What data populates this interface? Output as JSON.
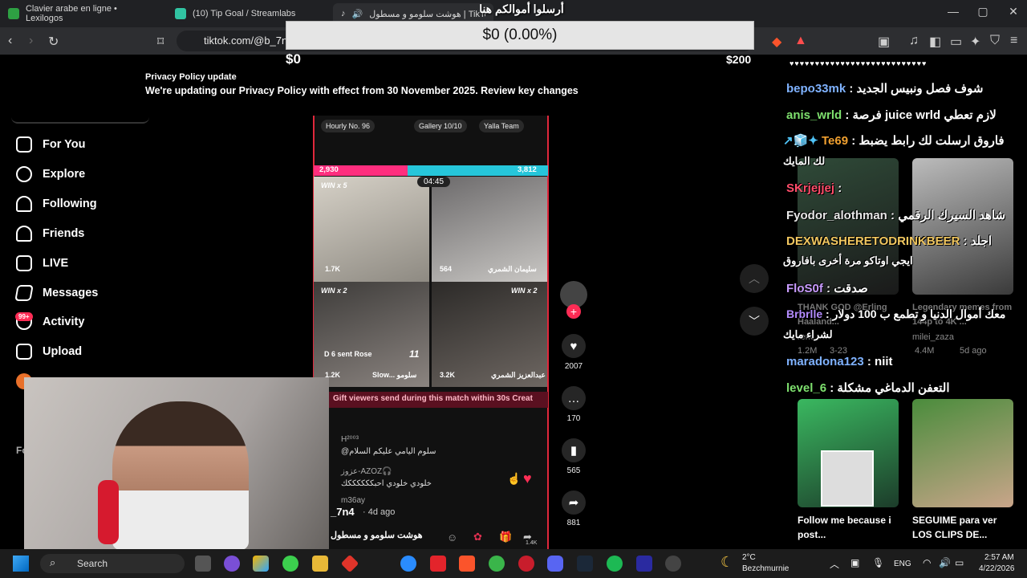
{
  "tabs": [
    {
      "title": "Clavier arabe en ligne • Lexilogos",
      "active": false
    },
    {
      "title": "(10) Tip Goal / Streamlabs",
      "active": false
    },
    {
      "title": "هوشت سلومو و مسطول | TikTok",
      "active": true
    }
  ],
  "window_controls": {
    "minimize": "—",
    "maximize": "▢",
    "close": "✕"
  },
  "url": "tiktok.com/@b_7n4",
  "tip_goal": {
    "title": "أرسلوا أموالكم هنا",
    "progress_text": "$0 (0.00%)",
    "progress_fraction": 0,
    "min": "$0",
    "max": "$200"
  },
  "privacy": {
    "title": "Privacy Policy update",
    "body": "We're updating our Privacy Policy with effect from 30 November 2025. Review key changes"
  },
  "sidebar": {
    "items": [
      {
        "label": "For You",
        "icon": "home-icon"
      },
      {
        "label": "Explore",
        "icon": "compass-icon"
      },
      {
        "label": "Following",
        "icon": "following-icon"
      },
      {
        "label": "Friends",
        "icon": "friends-icon"
      },
      {
        "label": "LIVE",
        "icon": "live-icon"
      },
      {
        "label": "Messages",
        "icon": "messages-icon"
      },
      {
        "label": "Activity",
        "icon": "activity-icon"
      },
      {
        "label": "Upload",
        "icon": "upload-icon"
      }
    ],
    "activity_badge": "99+",
    "partial_label": "Fo"
  },
  "video": {
    "top_chips": [
      "Hourly No. 96",
      "Gallery 10/10",
      "Yalla Team"
    ],
    "score_left": "2,930",
    "score_right": "3,812",
    "timer": "04:45",
    "cells": [
      {
        "badge": "WIN x 5",
        "count": "1.7K",
        "name": ""
      },
      {
        "badge": "",
        "count": "564",
        "name": "سليمان الشمري"
      },
      {
        "badge": "WIN x 2",
        "count": "1.2K",
        "name": "Slow... سلومو",
        "gift_text": "D 6 sent Rose",
        "gift_count": "11"
      },
      {
        "badge": "WIN x 2",
        "count": "3.2K",
        "name": "عبدالعزيز الشمري"
      }
    ],
    "gift_bar": "Gift viewers send during this match within 30s   Creat",
    "comments": [
      {
        "user": "H²⁰⁰³",
        "text": "@سلوم اليامي عليكم السلام"
      },
      {
        "user": "عزوز-AZOZ🎧",
        "text": "خلودي خلودي احبككككككك"
      },
      {
        "user": "m36ay",
        "text": ""
      }
    ],
    "username": "_7n4",
    "date": "· 4d ago",
    "title": "هوشت سلومو و مسطول",
    "small_count": "1.4K"
  },
  "actions": [
    {
      "name": "like",
      "icon": "♥",
      "count": "2007"
    },
    {
      "name": "comment",
      "icon": "…",
      "count": "170"
    },
    {
      "name": "save",
      "icon": "▮",
      "count": "565"
    },
    {
      "name": "share",
      "icon": "➦",
      "count": "881"
    }
  ],
  "chat": {
    "header": "♥♥♥♥♥♥♥♥♥♥♥♥♥♥♥♥♥♥♥♥♥♥♥♥♥♥♥",
    "messages": [
      {
        "user": "bepo33mk",
        "color": "#7fb2ff",
        "text": " : شوف فصل ونبيس الجديد"
      },
      {
        "user": "anis_wrld",
        "color": "#7ee06e",
        "text": " : فرصة juice wrld لازم تعطي"
      },
      {
        "user": "Te69",
        "color": "#f0a030",
        "prefix": "↗🧊✦ ",
        "text": " : فاروق ارسلت لك رابط يضبط"
      },
      {
        "user": "",
        "color": "#fff",
        "text": "لك المايك"
      },
      {
        "user": "SKrjejjej",
        "color": "#ff4d6a",
        "text": " :"
      },
      {
        "user": "Fyodor_alothman",
        "color": "#e8e8e8",
        "text": " : شاهد السيرك الرقمي"
      },
      {
        "user": "DEXWASHERETODRINKBEER",
        "color": "#f2c860",
        "text": " : اجلد"
      },
      {
        "user": "",
        "color": "#fff",
        "text": "ايجي اوتاكو مرة أخرى بافاروق"
      },
      {
        "user": "FloS0f",
        "color": "#c99cff",
        "text": " : صدقت"
      },
      {
        "user": "Brbrlle",
        "color": "#b48cff",
        "text": " : معك أموال الدنيا و تطمع ب 100 دولار"
      },
      {
        "user": "",
        "color": "#fff",
        "text": "لشراء مايك"
      },
      {
        "user": "maradona123",
        "color": "#7fb2ff",
        "text": " : niit"
      },
      {
        "user": "level_6",
        "color": "#7ee06e",
        "text": " : التعفن الدماغي مشكلة"
      }
    ],
    "background_cards": [
      {
        "title": "THANK GOD @Erling Haaland...",
        "author": "rerki",
        "likes": "1.2M",
        "date": "3-23"
      },
      {
        "title": "Legendary memes from 144p to 4K ...",
        "author": "milei_zaza",
        "likes": "4.4M",
        "date": "5d ago"
      },
      {
        "title": "Follow me because i post...",
        "author": "",
        "likes": "",
        "date": ""
      },
      {
        "title": "SEGUIME para ver LOS CLIPS DE...",
        "author": "",
        "likes": "",
        "date": ""
      }
    ]
  },
  "taskbar": {
    "search": "Search",
    "weather_temp": "2°C",
    "weather_place": "Bezchmurnie",
    "lang": "ENG",
    "time": "2:57 AM",
    "date": "4/22/2026"
  }
}
